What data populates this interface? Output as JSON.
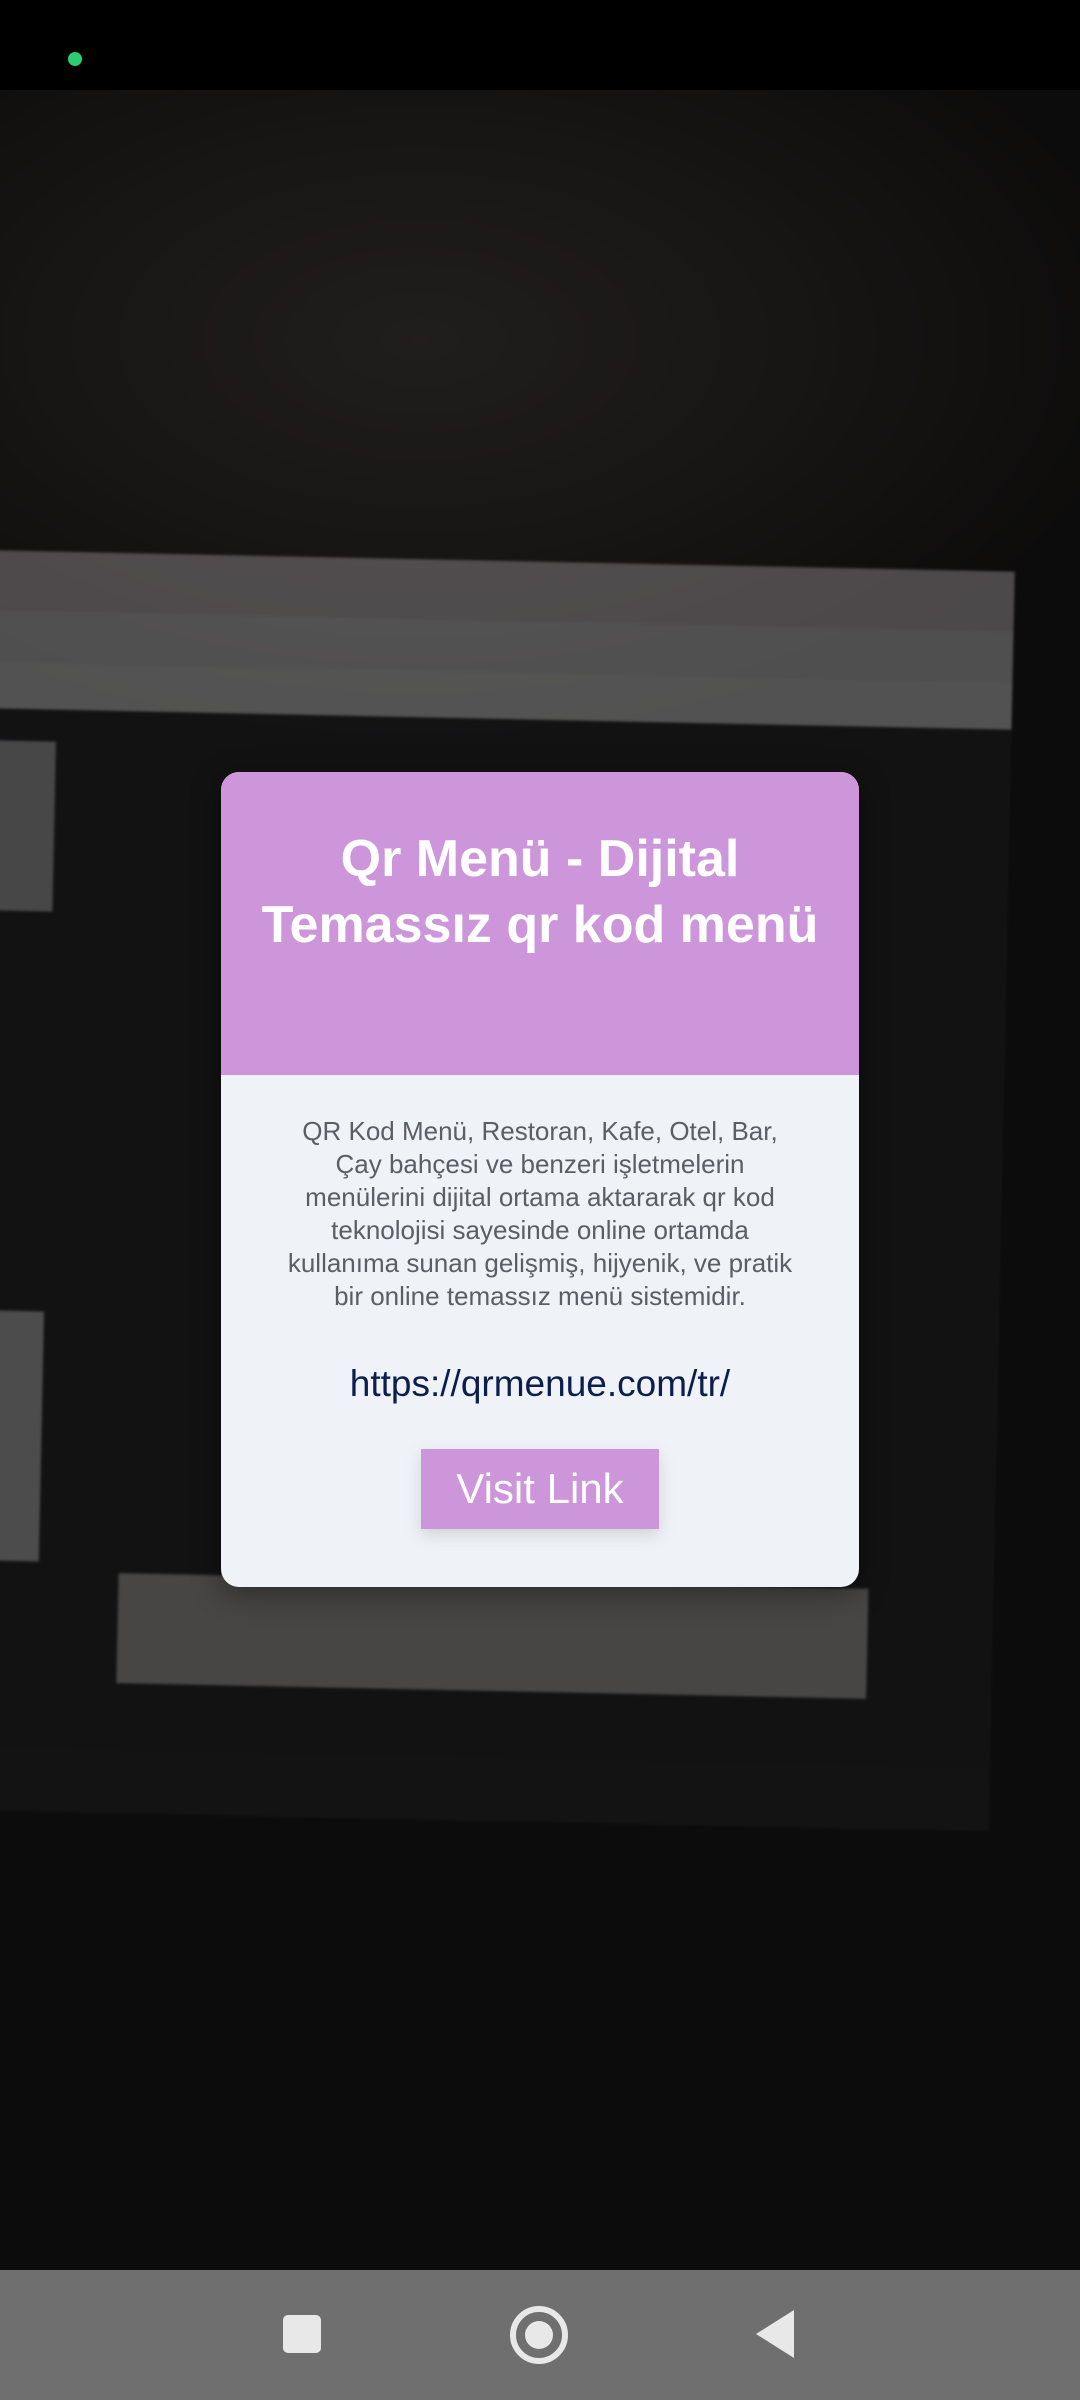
{
  "status_bar": {
    "indicator_color": "#2ecc71"
  },
  "modal": {
    "title": "Qr Menü - Dijital Temassız qr kod menü",
    "description": "QR Kod  Menü, Restoran, Kafe, Otel, Bar, Çay bahçesi ve benzeri işletmelerin menülerini dijital ortama aktararak qr kod teknolojisi sayesinde online ortamda kullanıma sunan gelişmiş, hijyenik, ve pratik bir online temassız menü sistemidir.",
    "link_text": "https://qrmenue.com/tr/",
    "button_label": "Visit Link",
    "header_color": "#cd95da",
    "body_color": "#eff3f7"
  },
  "nav_bar": {
    "recents_icon": "square-icon",
    "home_icon": "circle-icon",
    "back_icon": "triangle-left-icon"
  }
}
